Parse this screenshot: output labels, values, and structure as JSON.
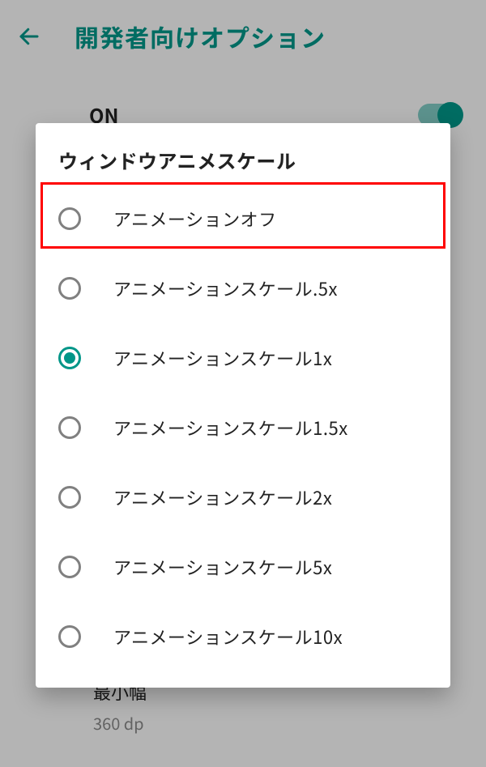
{
  "header": {
    "title": "開発者向けオプション"
  },
  "toggle": {
    "label": "ON"
  },
  "dialog": {
    "title": "ウィンドウアニメスケール",
    "options": [
      {
        "label": "アニメーションオフ",
        "selected": false
      },
      {
        "label": "アニメーションスケール.5x",
        "selected": false
      },
      {
        "label": "アニメーションスケール1x",
        "selected": true
      },
      {
        "label": "アニメーションスケール1.5x",
        "selected": false
      },
      {
        "label": "アニメーションスケール2x",
        "selected": false
      },
      {
        "label": "アニメーションスケール5x",
        "selected": false
      },
      {
        "label": "アニメーションスケール10x",
        "selected": false
      }
    ]
  },
  "bottom": {
    "title": "最小幅",
    "sub": "360 dp"
  },
  "highlight_index": 0
}
